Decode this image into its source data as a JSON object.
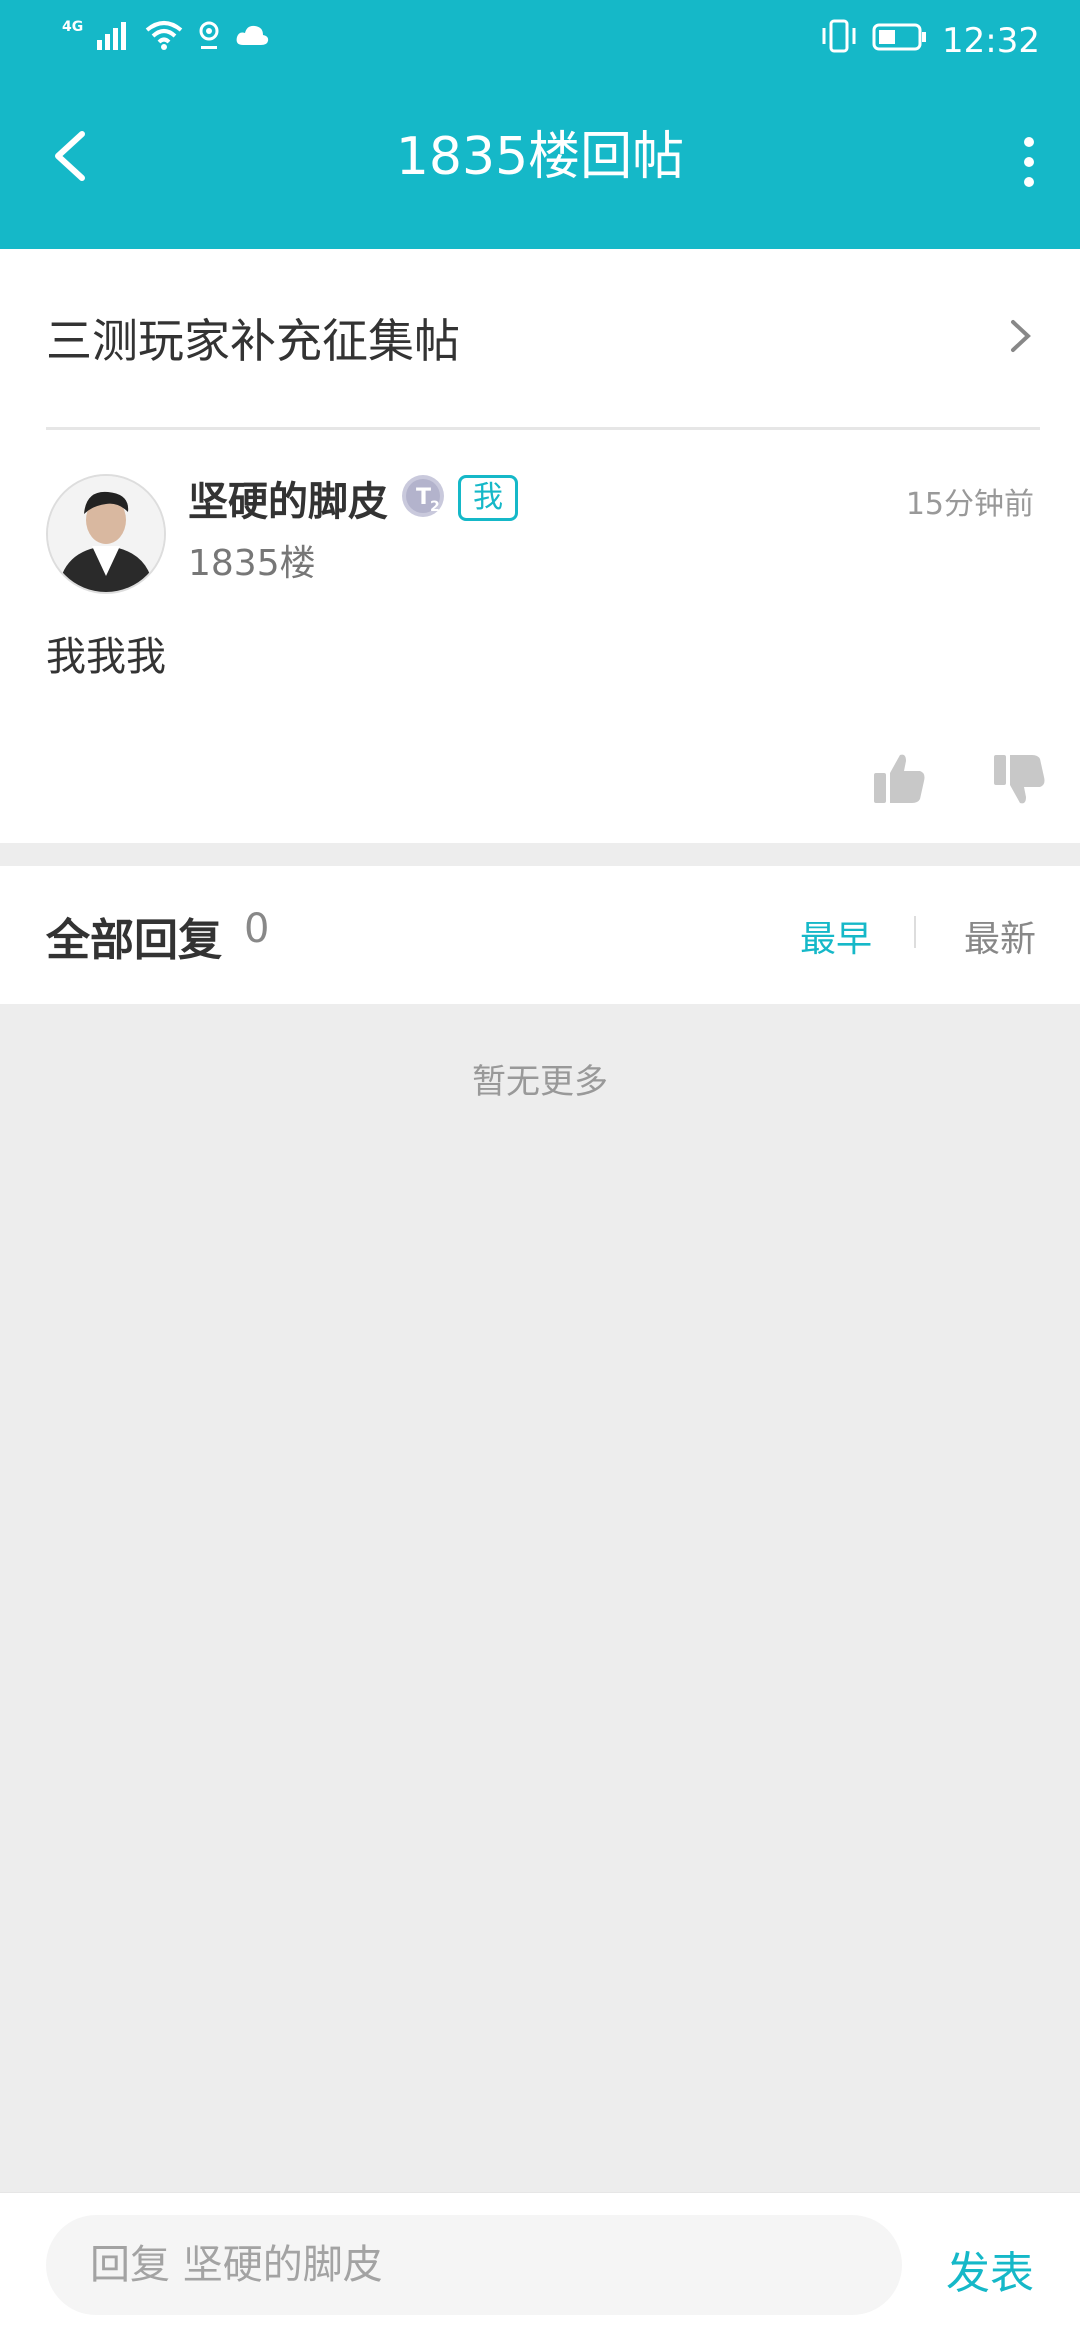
{
  "status_bar": {
    "network": "4G",
    "time": "12:32"
  },
  "header": {
    "title": "1835楼回帖"
  },
  "thread": {
    "title": "三测玩家补充征集帖"
  },
  "post": {
    "author": "坚硬的脚皮",
    "level_badge": "T2",
    "me_badge": "我",
    "floor": "1835楼",
    "time": "15分钟前",
    "content": "我我我"
  },
  "replies": {
    "title": "全部回复",
    "count": "0",
    "sort_earliest": "最早",
    "sort_newest": "最新",
    "empty_text": "暂无更多"
  },
  "composer": {
    "placeholder": "回复 坚硬的脚皮",
    "send_label": "发表"
  },
  "colors": {
    "accent": "#15b8c8",
    "background": "#ededed"
  },
  "icons": [
    "back-icon",
    "more-icon",
    "chevron-right-icon",
    "thumbs-up-icon",
    "thumbs-down-icon",
    "signal-icon",
    "wifi-icon",
    "location-icon",
    "cloud-icon",
    "vibrate-icon",
    "battery-icon"
  ]
}
